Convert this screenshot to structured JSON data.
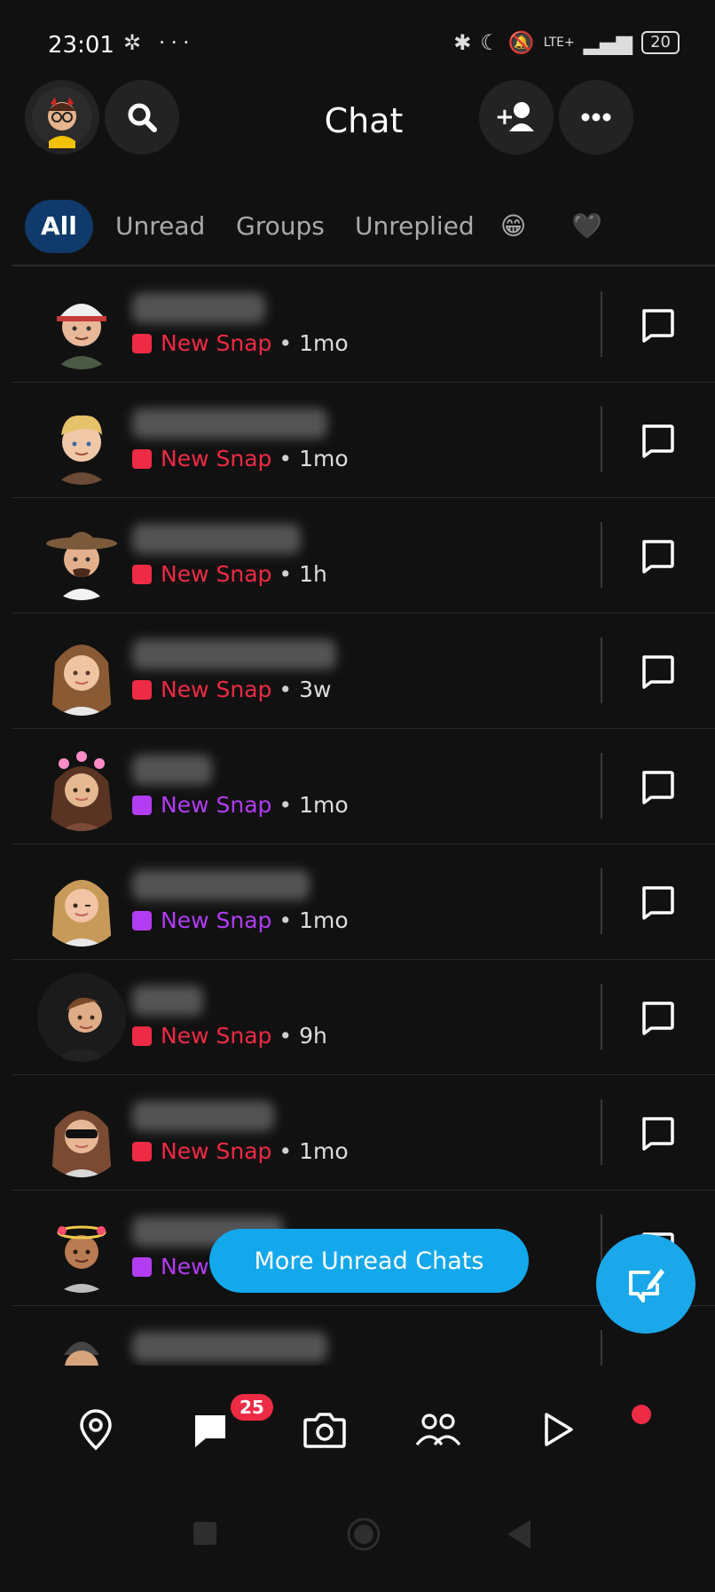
{
  "status_bar": {
    "time": "23:01",
    "left_icons": "✲ ···",
    "network": "LTE+",
    "battery": "20"
  },
  "header": {
    "title": "Chat"
  },
  "tabs": [
    {
      "label": "All",
      "active": true
    },
    {
      "label": "Unread"
    },
    {
      "label": "Groups"
    },
    {
      "label": "Unreplied"
    },
    {
      "label": "😁"
    },
    {
      "label": "🖤"
    }
  ],
  "chats": [
    {
      "status": "New Snap",
      "age": "1mo",
      "status_color": "#ee2b45"
    },
    {
      "status": "New Snap",
      "age": "1mo",
      "status_color": "#ee2b45"
    },
    {
      "status": "New Snap",
      "age": "1h",
      "status_color": "#ee2b45"
    },
    {
      "status": "New Snap",
      "age": "3w",
      "status_color": "#ee2b45"
    },
    {
      "status": "New Snap",
      "age": "1mo",
      "status_color": "#b23cf2"
    },
    {
      "status": "New Snap",
      "age": "1mo",
      "status_color": "#b23cf2"
    },
    {
      "status": "New Snap",
      "age": "9h",
      "status_color": "#ee2b45"
    },
    {
      "status": "New Snap",
      "age": "1mo",
      "status_color": "#ee2b45"
    },
    {
      "status": "New",
      "age": "",
      "status_color": "#b23cf2"
    }
  ],
  "more_unread_label": "More Unread Chats",
  "bottom_nav": {
    "chat_badge": "25"
  },
  "colors": {
    "background": "#111111",
    "accent_blue": "#13a8ec",
    "snap_red": "#ee2b45",
    "snap_purple": "#b23cf2"
  }
}
